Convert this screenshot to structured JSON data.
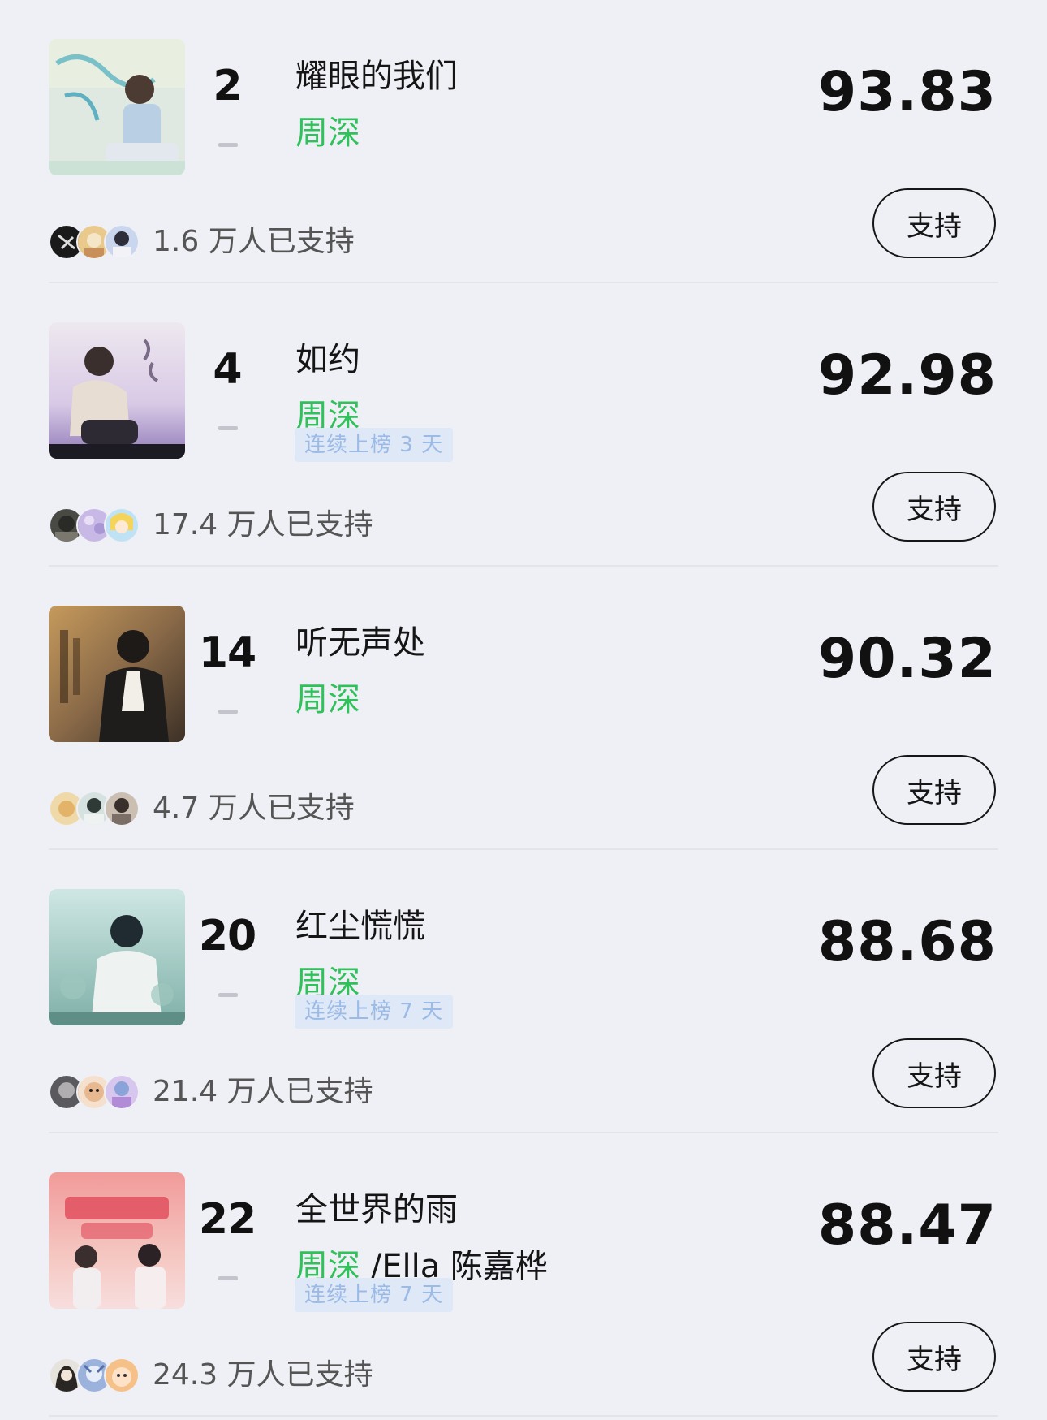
{
  "songs": [
    {
      "rank": "2",
      "title": "耀眼的我们",
      "artist": "周深",
      "artist_extra": "",
      "streak": "",
      "score": "93.83",
      "supporters": "1.6 万人已支持",
      "button_label": "支持"
    },
    {
      "rank": "4",
      "title": "如约",
      "artist": "周深",
      "artist_extra": "",
      "streak": "连续上榜 3 天",
      "score": "92.98",
      "supporters": "17.4 万人已支持",
      "button_label": "支持"
    },
    {
      "rank": "14",
      "title": "听无声处",
      "artist": "周深",
      "artist_extra": "",
      "streak": "",
      "score": "90.32",
      "supporters": "4.7 万人已支持",
      "button_label": "支持"
    },
    {
      "rank": "20",
      "title": "红尘慌慌",
      "artist": "周深",
      "artist_extra": "",
      "streak": "连续上榜 7 天",
      "score": "88.68",
      "supporters": "21.4 万人已支持",
      "button_label": "支持"
    },
    {
      "rank": "22",
      "title": "全世界的雨",
      "artist": "周深",
      "artist_extra": " /Ella 陈嘉桦",
      "streak": "连续上榜 7 天",
      "score": "88.47",
      "supporters": "24.3 万人已支持",
      "button_label": "支持"
    }
  ],
  "colors": {
    "background": "#eff0f5",
    "artist_green": "#2fc25b",
    "streak_bg": "#dfe8f6",
    "streak_text": "#9bbbe6"
  }
}
